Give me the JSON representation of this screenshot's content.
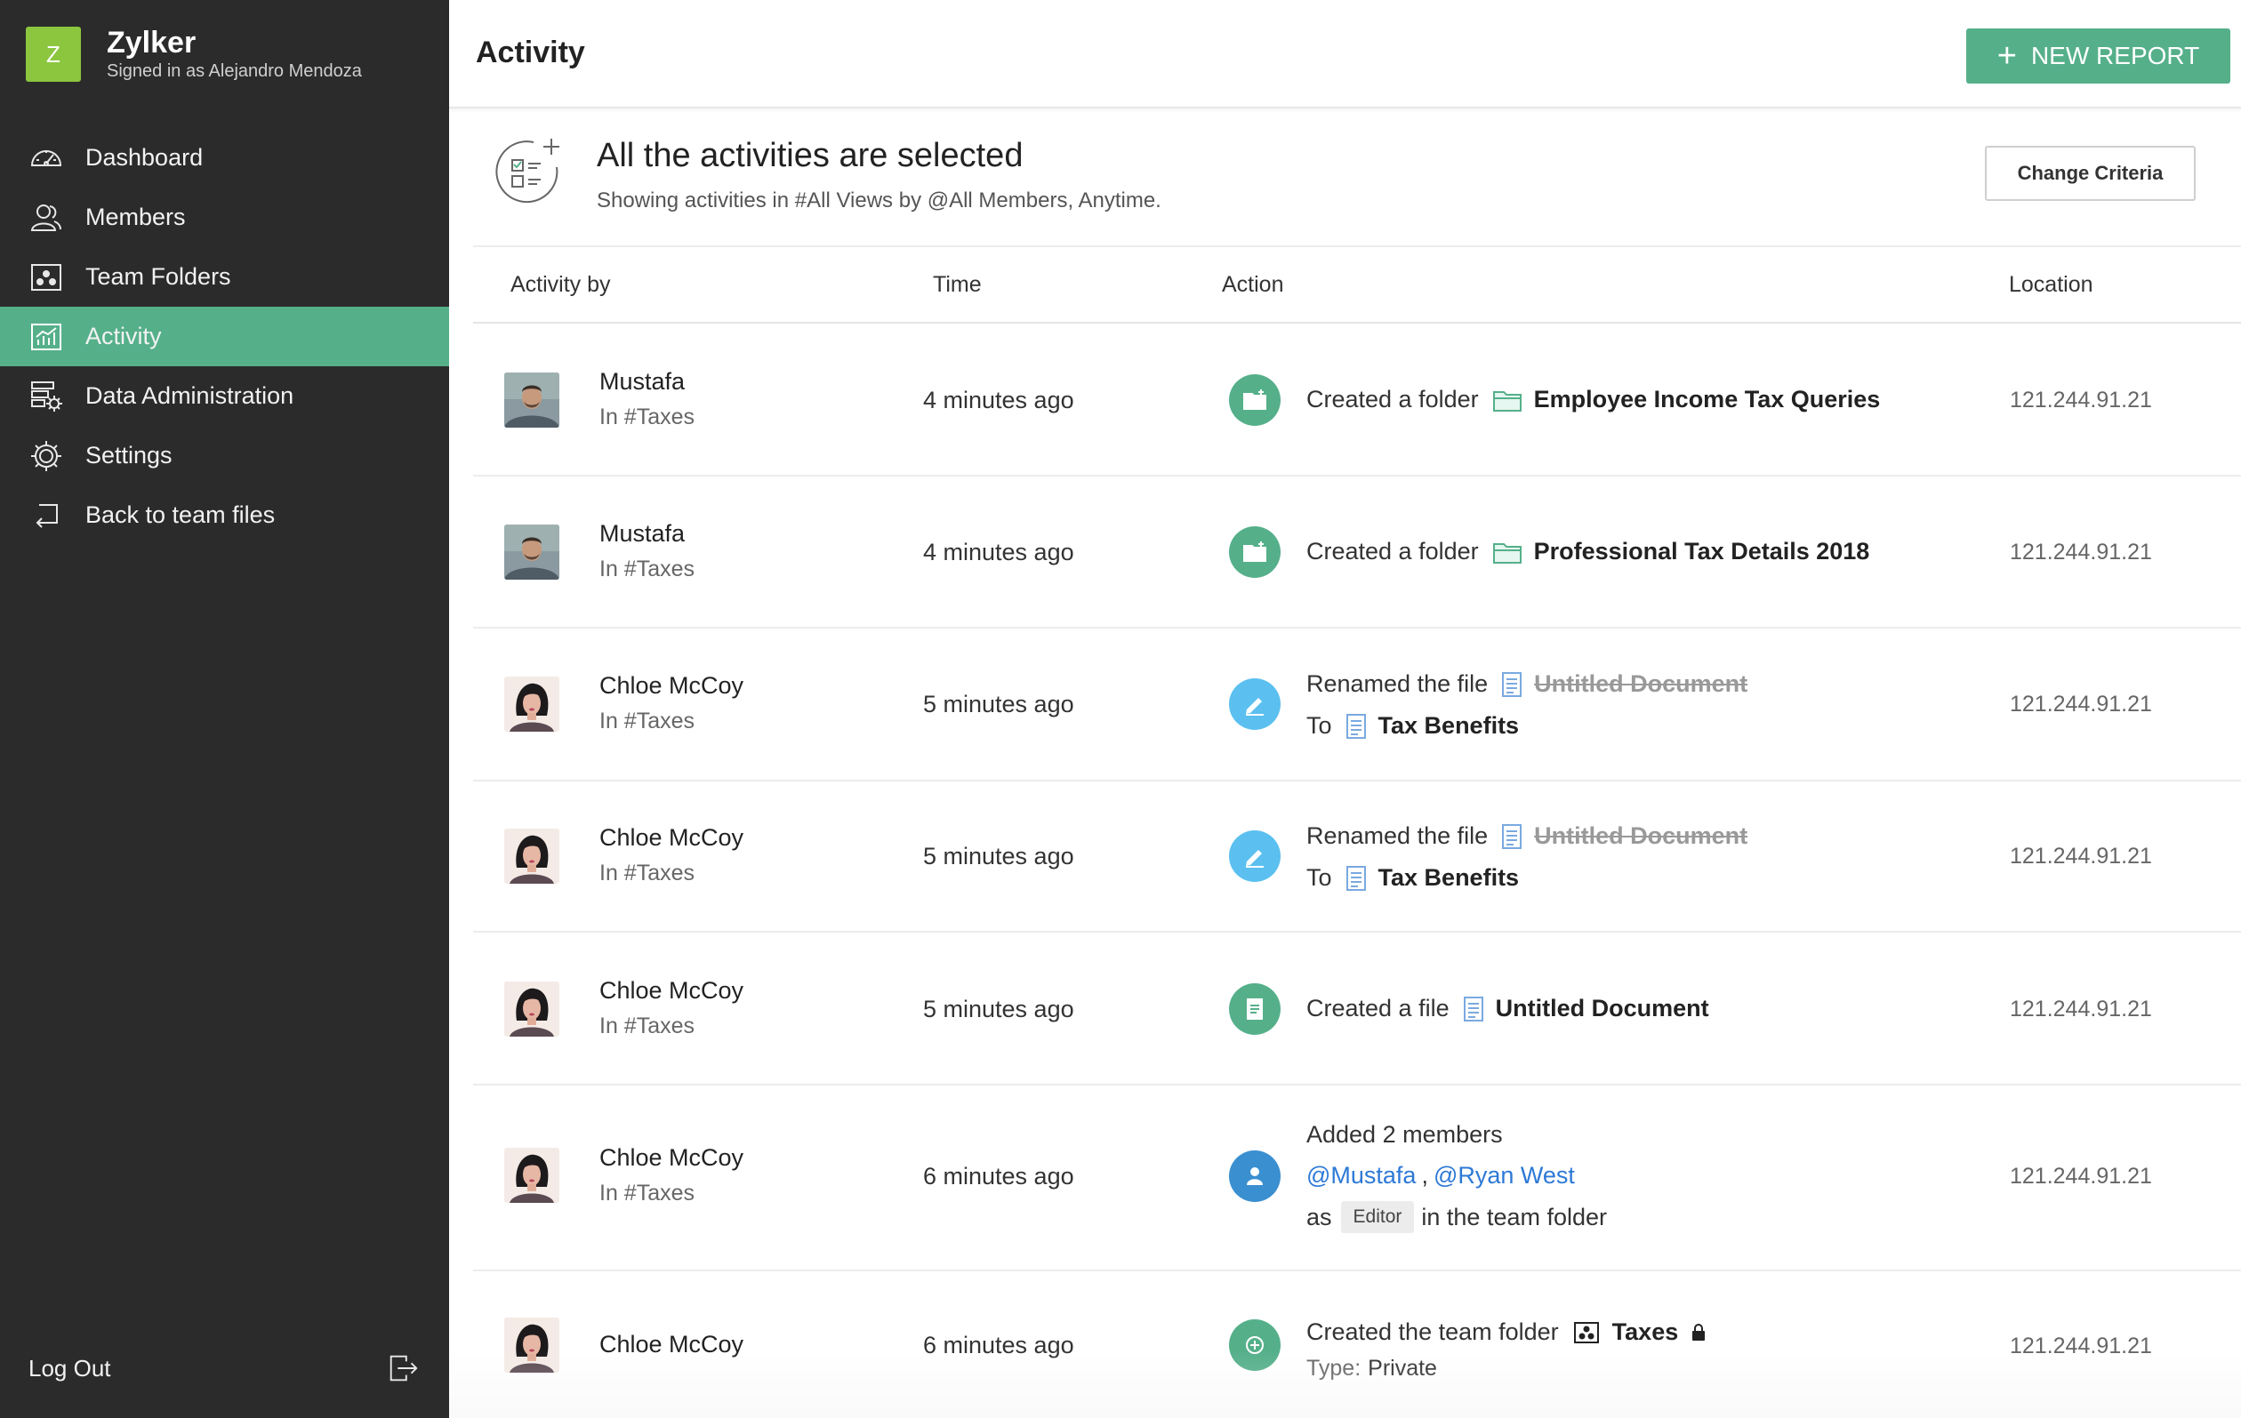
{
  "brand": {
    "logo_letter": "Z",
    "name": "Zylker",
    "signed_in": "Signed in as Alejandro Mendoza",
    "logo_color": "#8cc63f"
  },
  "sidebar": {
    "items": [
      {
        "label": "Dashboard",
        "icon": "dashboard-icon"
      },
      {
        "label": "Members",
        "icon": "members-icon"
      },
      {
        "label": "Team Folders",
        "icon": "team-folders-icon"
      },
      {
        "label": "Activity",
        "icon": "activity-icon",
        "active": true
      },
      {
        "label": "Data Administration",
        "icon": "data-admin-icon"
      },
      {
        "label": "Settings",
        "icon": "gear-icon"
      },
      {
        "label": "Back to team files",
        "icon": "back-arrow-icon"
      }
    ],
    "logout": "Log Out",
    "active_color": "#55b08a"
  },
  "header": {
    "title": "Activity",
    "new_report": "NEW REPORT"
  },
  "criteria": {
    "title": "All the activities are selected",
    "subtitle": "Showing activities in #All Views by @All Members, Anytime.",
    "button": "Change Criteria"
  },
  "table": {
    "headers": {
      "activity_by": "Activity by",
      "time": "Time",
      "action": "Action",
      "location": "Location"
    },
    "rows": [
      {
        "name": "Mustafa",
        "team": "In #Taxes",
        "time": "4 minutes ago",
        "verb": "Created a folder",
        "target": "Employee Income Tax Queries",
        "location": "121.244.91.21"
      },
      {
        "name": "Mustafa",
        "team": "In #Taxes",
        "time": "4 minutes ago",
        "verb": "Created a folder",
        "target": "Professional Tax Details 2018",
        "location": "121.244.91.21"
      },
      {
        "name": "Chloe McCoy",
        "team": "In #Taxes",
        "time": "5 minutes ago",
        "verb": "Renamed the file",
        "old_name": "Untitled Document",
        "to": "To",
        "new_name": "Tax Benefits",
        "location": "121.244.91.21"
      },
      {
        "name": "Chloe McCoy",
        "team": "In #Taxes",
        "time": "5 minutes ago",
        "verb": "Renamed the file",
        "old_name": "Untitled Document",
        "to": "To",
        "new_name": "Tax Benefits",
        "location": "121.244.91.21"
      },
      {
        "name": "Chloe McCoy",
        "team": "In #Taxes",
        "time": "5 minutes ago",
        "verb": "Created a file",
        "target": "Untitled Document",
        "location": "121.244.91.21"
      },
      {
        "name": "Chloe McCoy",
        "team": "In #Taxes",
        "time": "6 minutes ago",
        "verb": "Added 2 members",
        "member1": "@Mustafa",
        "separator": ",",
        "member2": "@Ryan West",
        "as": "as",
        "role": "Editor",
        "suffix": "in the team folder",
        "location": "121.244.91.21"
      },
      {
        "name": "Chloe McCoy",
        "time": "6 minutes ago",
        "verb": "Created the team folder",
        "target": "Taxes",
        "type_label": "Type:",
        "type_value": "Private",
        "location": "121.244.91.21"
      }
    ]
  },
  "colors": {
    "folder_green": "#55b08a",
    "edit_blue": "#5bc0f0",
    "user_blue": "#3a8fd0",
    "mention_blue": "#2d79d6"
  }
}
